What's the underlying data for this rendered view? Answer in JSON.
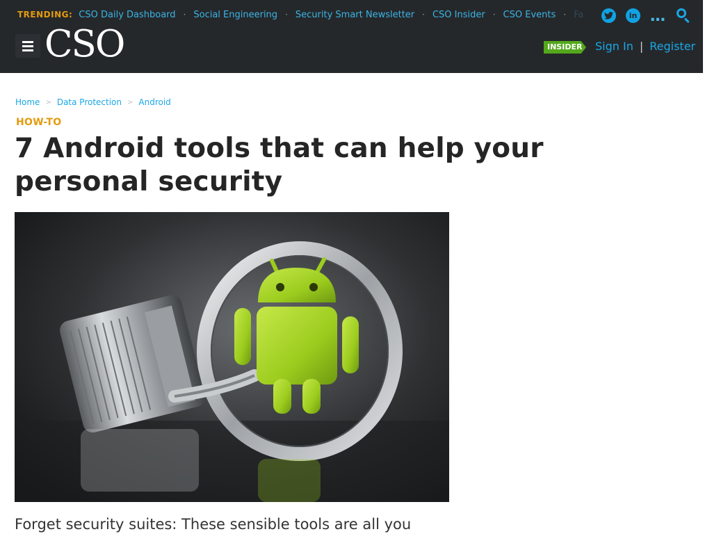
{
  "header": {
    "trending_label": "TRENDING:",
    "trending_links": [
      "CSO Daily Dashboard",
      "Social Engineering",
      "Security Smart Newsletter",
      "CSO Insider",
      "CSO Events",
      "Fa"
    ],
    "social_icons": [
      "twitter-icon",
      "linkedin-icon"
    ],
    "logo_text": "CSO",
    "insider_badge": "INSIDER",
    "sign_in": "Sign In",
    "auth_separator": "|",
    "register": "Register"
  },
  "article": {
    "breadcrumb": [
      "Home",
      "Data Protection",
      "Android"
    ],
    "kicker": "HOW-TO",
    "headline": "7 Android tools that can help your personal security",
    "dek": "Forget security suites: These sensible tools are all you"
  },
  "colors": {
    "header_bg": "#25282b",
    "link": "#1aa7e6",
    "accent_orange": "#e49b0f",
    "insider_green": "#53a81b",
    "android_green": "#9ccc1e"
  }
}
